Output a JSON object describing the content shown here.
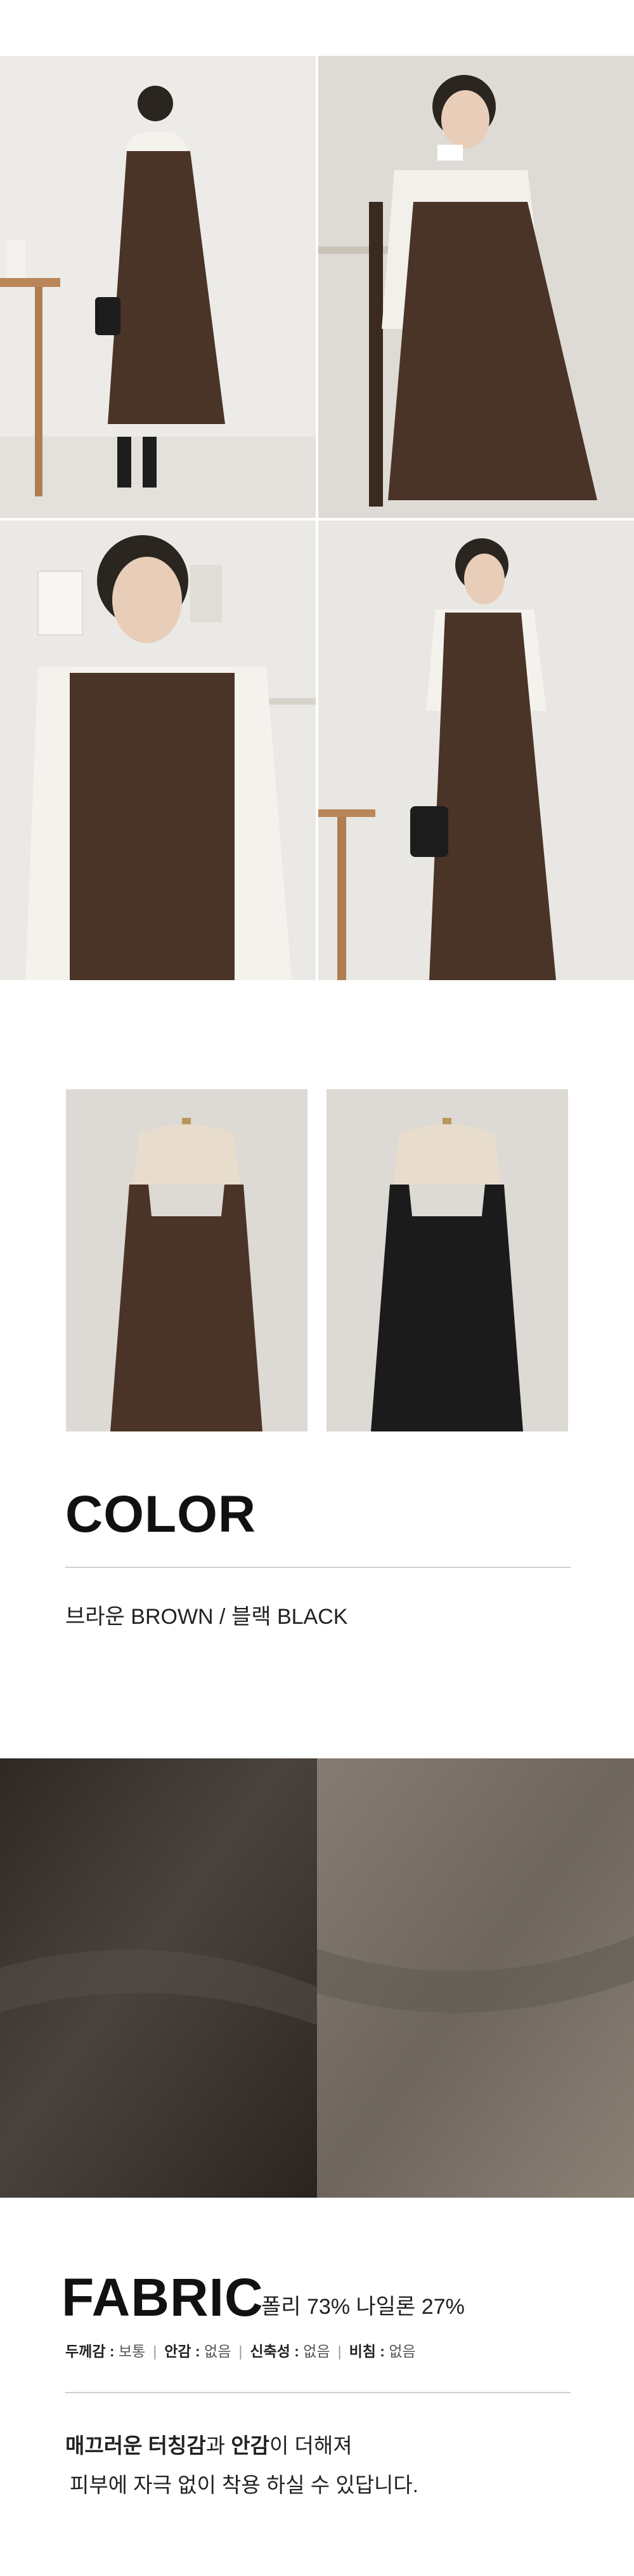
{
  "gallery": {
    "photos": [
      {
        "subject": "model standing in brown pinafore dress with white blouse"
      },
      {
        "subject": "model seated holding white cup"
      },
      {
        "subject": "model close-up with arms crossed"
      },
      {
        "subject": "model standing with black handbag"
      }
    ]
  },
  "color_section": {
    "title": "COLOR",
    "swatches": [
      {
        "name": "brown",
        "hex": "#4a3427"
      },
      {
        "name": "black",
        "hex": "#1b1b1b"
      }
    ],
    "options_prefix": "브라운 BROWN",
    "options_separator": " / ",
    "options_suffix": "블랙 BLACK"
  },
  "fabric_section": {
    "title": "FABRIC",
    "composition": "폴리 73% 나일론 27%",
    "properties": [
      {
        "label": "두께감",
        "value": "보통"
      },
      {
        "label": "안감",
        "value": "없음"
      },
      {
        "label": "신축성",
        "value": "없음"
      },
      {
        "label": "비침",
        "value": "없음"
      }
    ],
    "desc_line1_a": "매끄러운 터칭감",
    "desc_line1_b": "과 ",
    "desc_line1_c": "안감",
    "desc_line1_d": "이 더해져",
    "desc_line2": "피부에 자극 없이 착용 하실 수 있답니다.",
    "swatch_colors": [
      "#3d3530",
      "#7a7268"
    ]
  }
}
